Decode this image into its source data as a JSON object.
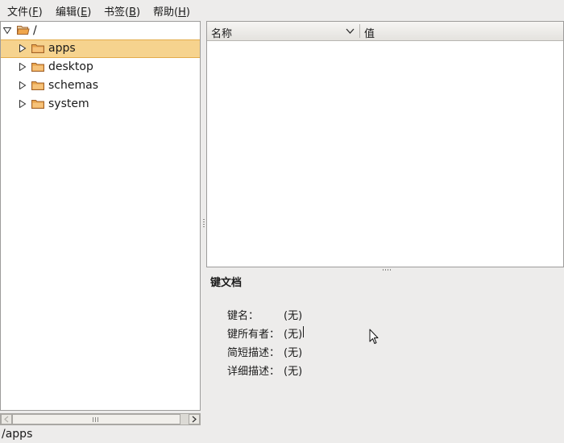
{
  "menubar": {
    "file": {
      "text": "文件(",
      "mnemonic": "F",
      "close": ")"
    },
    "edit": {
      "text": "编辑(",
      "mnemonic": "E",
      "close": ")"
    },
    "bookmarks": {
      "text": "书签(",
      "mnemonic": "B",
      "close": ")"
    },
    "help": {
      "text": "帮助(",
      "mnemonic": "H",
      "close": ")"
    }
  },
  "tree": {
    "root": {
      "label": "/",
      "expanded": true,
      "icon": "folder-open-icon"
    },
    "items": [
      {
        "label": "apps",
        "selected": true,
        "icon": "folder-icon"
      },
      {
        "label": "desktop",
        "selected": false,
        "icon": "folder-icon"
      },
      {
        "label": "schemas",
        "selected": false,
        "icon": "folder-icon"
      },
      {
        "label": "system",
        "selected": false,
        "icon": "folder-icon"
      }
    ]
  },
  "list": {
    "columns": [
      {
        "label": "名称",
        "has_sort_arrow": true
      },
      {
        "label": "值",
        "has_sort_arrow": false
      }
    ],
    "rows": []
  },
  "key_doc": {
    "title": "键文档",
    "fields": [
      {
        "label": "键名：",
        "value": "(无)"
      },
      {
        "label": "键所有者：",
        "value": "(无)"
      },
      {
        "label": "简短描述：",
        "value": "(无)"
      },
      {
        "label": "详细描述：",
        "value": "(无)"
      }
    ]
  },
  "status": {
    "path": "/apps"
  },
  "colors": {
    "selection": "#f6d38e",
    "selection_border": "#e3ac4a",
    "folder": "#e8a34a",
    "window_bg": "#edeceb"
  }
}
